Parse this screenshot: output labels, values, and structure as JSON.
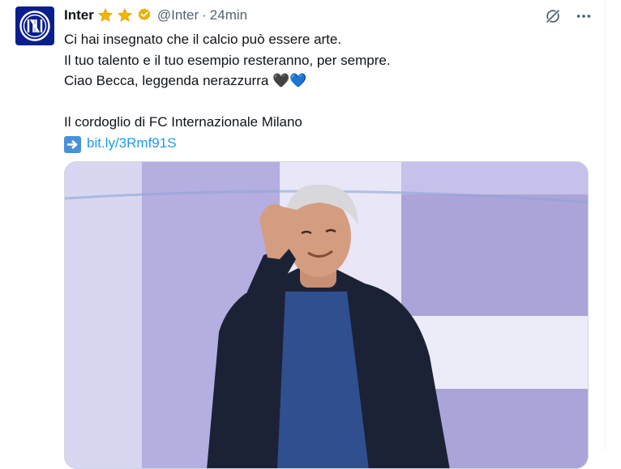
{
  "tweet": {
    "author_name": "Inter",
    "handle": "@Inter",
    "separator": "·",
    "time": "24min",
    "lines": [
      "Ci hai insegnato che il calcio può essere arte.",
      "Il tuo talento e il tuo esempio resteranno, per sempre.",
      "Ciao Becca, leggenda nerazzurra 🖤💙",
      "",
      "Il cordoglio di FC Internazionale Milano"
    ],
    "link_text": "bit.ly/3Rmf91S"
  },
  "icons": {
    "avatar": "inter-logo-icon",
    "stars": [
      "star-icon",
      "star-icon"
    ],
    "verified": "verified-badge-icon",
    "grok": "grok-icon",
    "more": "more-icon",
    "arrow": "arrow-right-emoji-icon"
  },
  "colors": {
    "accent": "#1d9bf0",
    "gold": "#f4b400",
    "inter_blue": "#0a1e8c",
    "secondary_text": "#536471"
  }
}
